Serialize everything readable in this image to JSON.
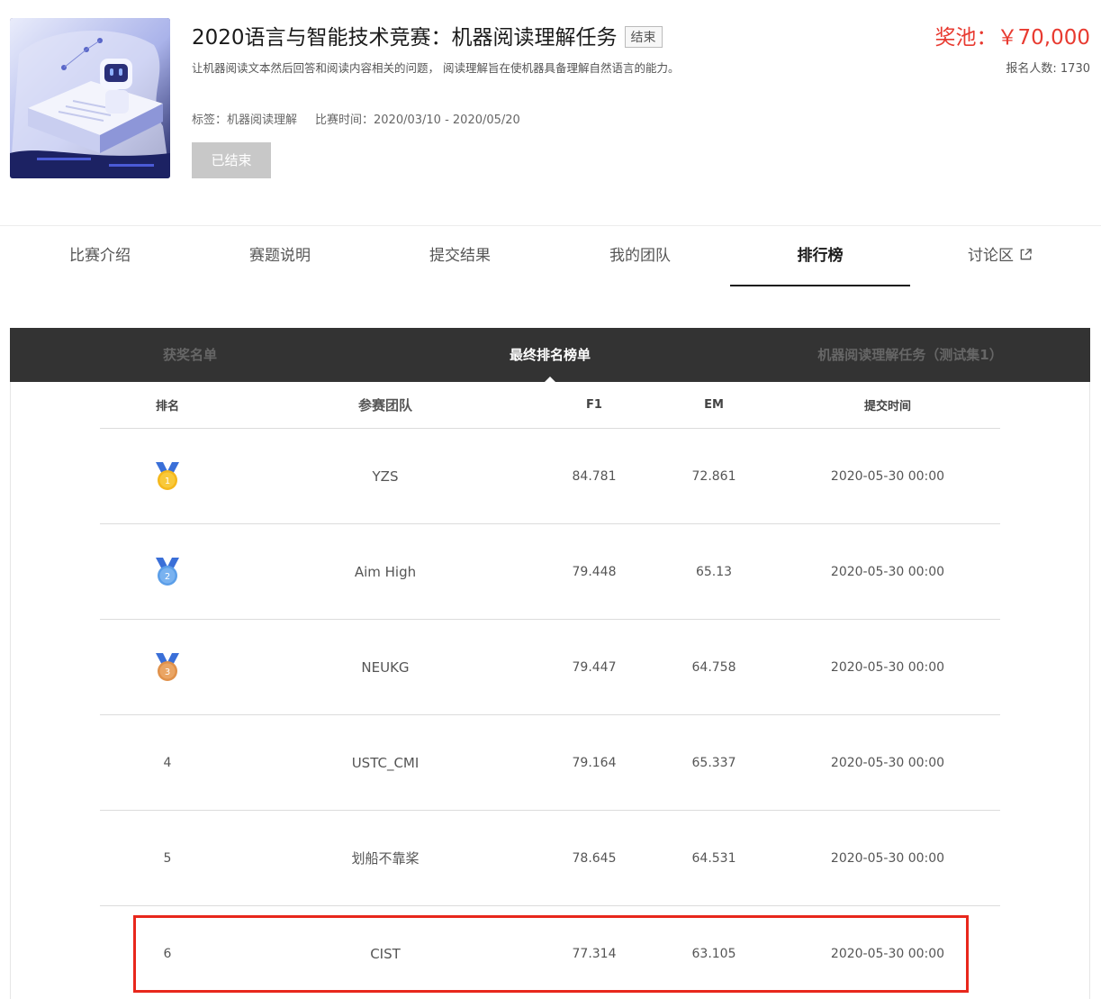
{
  "header": {
    "title": "2020语言与智能技术竞赛：机器阅读理解任务",
    "status_tag": "结束",
    "description": "让机器阅读文本然后回答和阅读内容相关的问题， 阅读理解旨在使机器具备理解自然语言的能力。",
    "tags": "标签：机器阅读理解",
    "period": "比赛时间：2020/03/10 - 2020/05/20",
    "ended_button": "已结束",
    "prize": "奖池：￥70,000",
    "signup": "报名人数: 1730"
  },
  "tabs": [
    {
      "label": "比赛介绍"
    },
    {
      "label": "赛题说明"
    },
    {
      "label": "提交结果"
    },
    {
      "label": "我的团队"
    },
    {
      "label": "排行榜"
    },
    {
      "label": "讨论区"
    }
  ],
  "active_tab": "排行榜",
  "subtabs": [
    {
      "label": "获奖名单"
    },
    {
      "label": "最终排名榜单"
    },
    {
      "label": "机器阅读理解任务（测试集1）"
    }
  ],
  "active_subtab": "最终排名榜单",
  "table": {
    "headers": {
      "rank": "排名",
      "team": "参赛团队",
      "f1": "F1",
      "em": "EM",
      "time": "提交时间"
    },
    "rows": [
      {
        "rank": "1",
        "team": "YZS",
        "f1": "84.781",
        "em": "72.861",
        "time": "2020-05-30 00:00",
        "medal": "gold"
      },
      {
        "rank": "2",
        "team": "Aim High",
        "f1": "79.448",
        "em": "65.13",
        "time": "2020-05-30 00:00",
        "medal": "silver"
      },
      {
        "rank": "3",
        "team": "NEUKG",
        "f1": "79.447",
        "em": "64.758",
        "time": "2020-05-30 00:00",
        "medal": "bronze"
      },
      {
        "rank": "4",
        "team": "USTC_CMI",
        "f1": "79.164",
        "em": "65.337",
        "time": "2020-05-30 00:00"
      },
      {
        "rank": "5",
        "team": "划船不靠桨",
        "f1": "78.645",
        "em": "64.531",
        "time": "2020-05-30 00:00"
      },
      {
        "rank": "6",
        "team": "CIST",
        "f1": "77.314",
        "em": "63.105",
        "time": "2020-05-30 00:00"
      }
    ]
  },
  "colors": {
    "prize": "#e83a30",
    "highlight": "#e8271c",
    "subtab_bar": "#333333",
    "medal_gold": "#f5b81c",
    "medal_silver": "#5b9ee8",
    "medal_bronze": "#e0914a",
    "ribbon": "#3a6fd8"
  }
}
